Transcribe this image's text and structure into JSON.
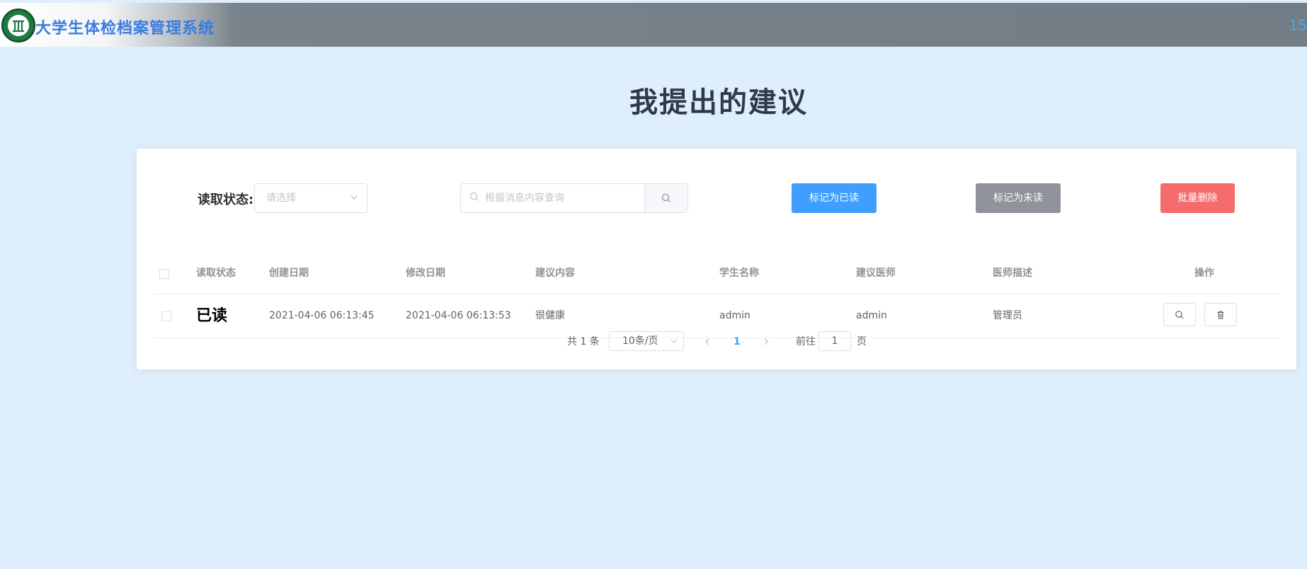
{
  "header": {
    "app_title": "大学生体检档案管理系统",
    "right_text": "15"
  },
  "page": {
    "title": "我提出的建议"
  },
  "filters": {
    "status_label": "读取状态:",
    "status_placeholder": "请选择",
    "search_placeholder": "根据消息内容查询"
  },
  "actions": {
    "mark_read": "标记为已读",
    "mark_unread": "标记为未读",
    "batch_delete": "批量删除"
  },
  "table": {
    "columns": [
      "读取状态",
      "创建日期",
      "修改日期",
      "建议内容",
      "学生名称",
      "建议医师",
      "医师描述",
      "操作"
    ],
    "rows": [
      {
        "status": "已读",
        "created": "2021-04-06 06:13:45",
        "modified": "2021-04-06 06:13:53",
        "content": "很健康",
        "student": "admin",
        "doctor": "admin",
        "doctor_desc": "管理员"
      }
    ]
  },
  "pagination": {
    "total": "共 1 条",
    "page_size": "10条/页",
    "current_page": "1",
    "goto_label": "前往",
    "goto_value": "1",
    "page_suffix": "页"
  },
  "colors": {
    "primary": "#409eff",
    "info": "#909399",
    "danger": "#f56c6c",
    "background": "#dfeefc"
  }
}
